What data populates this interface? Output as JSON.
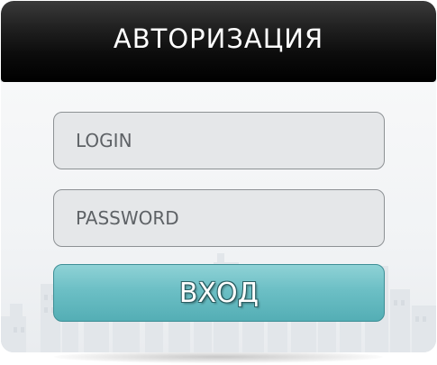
{
  "header": {
    "title": "АВТОРИЗАЦИЯ"
  },
  "form": {
    "login_placeholder": "LOGIN",
    "password_placeholder": "PASSWORD",
    "submit_label": "ВХОД"
  },
  "colors": {
    "header_bg": "#000000",
    "field_bg": "#e5e7e9",
    "button_accent": "#6cbfc5",
    "button_text": "#ffffff"
  }
}
